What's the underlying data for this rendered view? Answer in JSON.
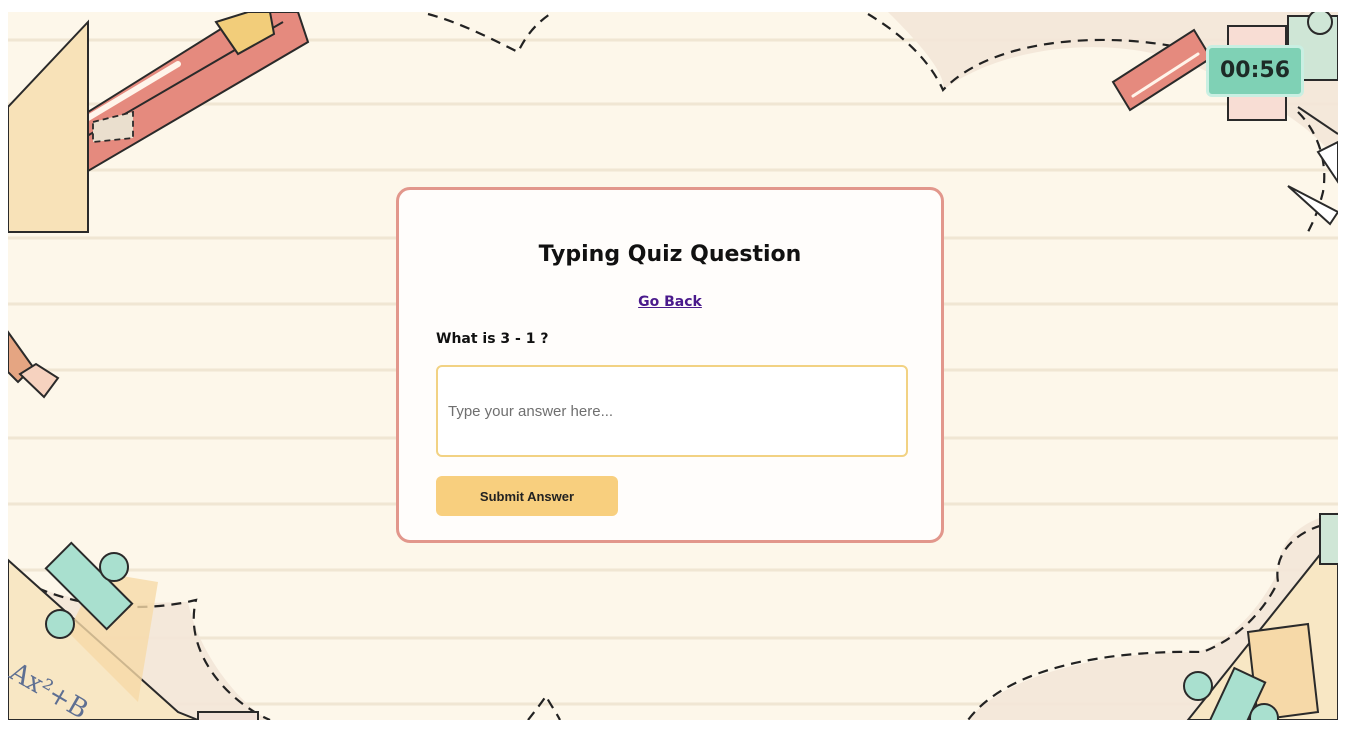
{
  "timer": {
    "text": "00:56"
  },
  "quiz": {
    "title": "Typing Quiz Question",
    "back_link": "Go Back",
    "question": "What is 3 - 1 ?",
    "answer_placeholder": "Type your answer here...",
    "answer_value": "",
    "submit_label": "Submit Answer"
  },
  "decoration": {
    "formula_text": "Ax²+B"
  },
  "colors": {
    "background": "#fdf7ea",
    "card_border": "#e2978c",
    "input_border": "#f2d283",
    "submit_button": "#f8cf7e",
    "timer_background": "#7fd1b5",
    "link": "#4a1a8c"
  }
}
